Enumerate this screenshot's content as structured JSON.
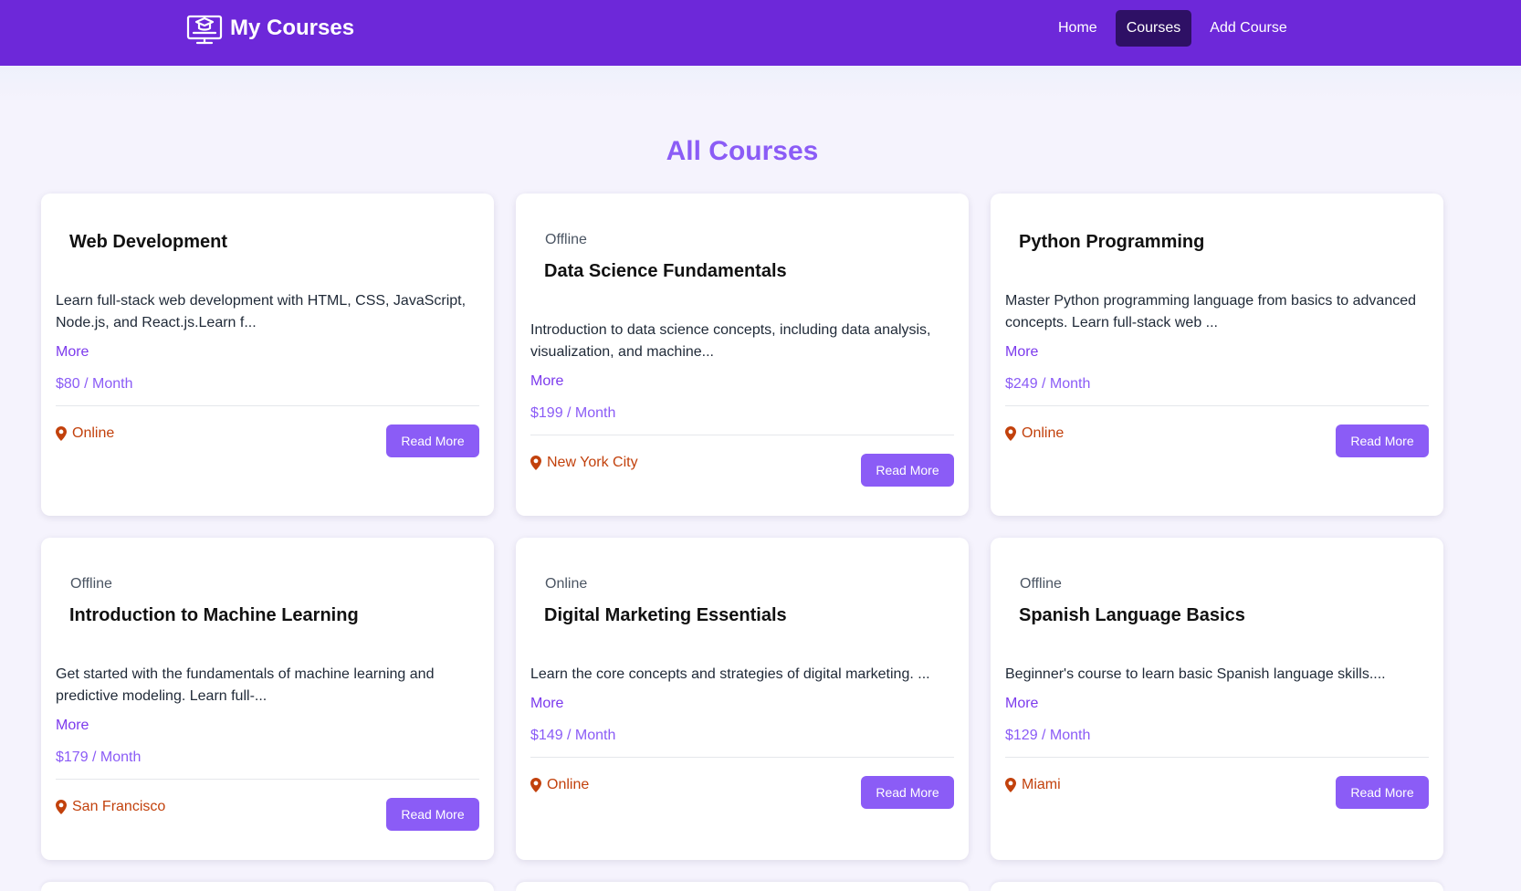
{
  "nav": {
    "brand": "My Courses",
    "links": [
      {
        "label": "Home",
        "active": false
      },
      {
        "label": "Courses",
        "active": true
      },
      {
        "label": "Add Course",
        "active": false
      }
    ]
  },
  "page": {
    "title": "All Courses"
  },
  "colors": {
    "navbar": "#6d28d9",
    "accent": "#8b5cf6",
    "active_nav": "#2e1065",
    "location": "#c2410c"
  },
  "courses": [
    {
      "mode": "",
      "title": "Web Development",
      "description": "Learn full-stack web development with HTML, CSS, JavaScript, Node.js, and React.js.Learn f...",
      "more": "More",
      "price": "$80 / Month",
      "location": "Online",
      "button": "Read More"
    },
    {
      "mode": "Offline",
      "title": "Data Science Fundamentals",
      "description": "Introduction to data science concepts, including data analysis, visualization, and machine...",
      "more": "More",
      "price": "$199 / Month",
      "location": "New York City",
      "button": "Read More"
    },
    {
      "mode": "",
      "title": "Python Programming",
      "description": "Master Python programming language from basics to advanced concepts. Learn full-stack web ...",
      "more": "More",
      "price": "$249 / Month",
      "location": "Online",
      "button": "Read More"
    },
    {
      "mode": "Offline",
      "title": "Introduction to Machine Learning",
      "description": "Get started with the fundamentals of machine learning and predictive modeling. Learn full-...",
      "more": "More",
      "price": "$179 / Month",
      "location": "San Francisco",
      "button": "Read More"
    },
    {
      "mode": "Online",
      "title": "Digital Marketing Essentials",
      "description": "Learn the core concepts and strategies of digital marketing. ...",
      "more": "More",
      "price": "$149 / Month",
      "location": "Online",
      "button": "Read More"
    },
    {
      "mode": "Offline",
      "title": "Spanish Language Basics",
      "description": "Beginner's course to learn basic Spanish language skills....",
      "more": "More",
      "price": "$129 / Month",
      "location": "Miami",
      "button": "Read More"
    }
  ]
}
